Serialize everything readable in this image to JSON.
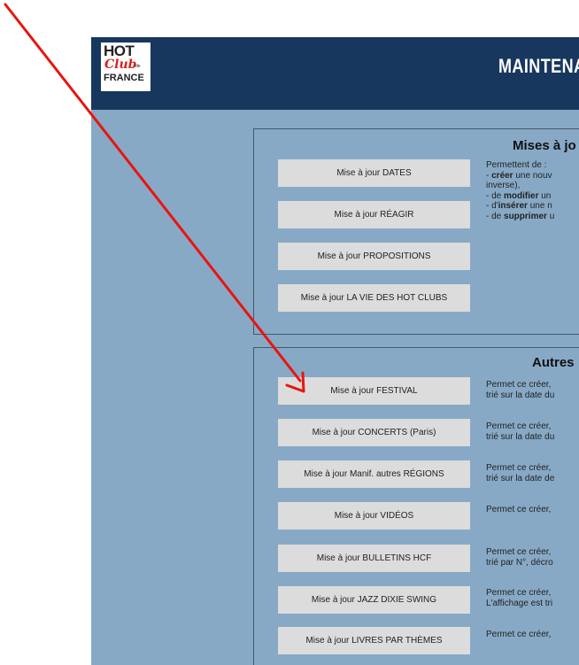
{
  "header": {
    "logo": {
      "line1": "HOT",
      "line2": "Club",
      "line2b": "de",
      "line3": "FRANCE"
    },
    "title": "MAINTENA"
  },
  "panel1": {
    "title": "Mises à jo",
    "buttons": [
      "Mise à jour DATES",
      "Mise à jour RÉAGIR",
      "Mise à jour PROPOSITIONS",
      "Mise à jour LA VIE DES HOT CLUBS"
    ],
    "desc": {
      "intro": "Permettent de :",
      "l1_dash": "- ",
      "l1_bold": "créer",
      "l1_rest": " une nouv",
      "l2": "inverse),",
      "l3_pre": "- de ",
      "l3_bold": "modifier",
      "l3_rest": " un",
      "l4_pre": "- d'",
      "l4_bold": "insérer",
      "l4_rest": " une n",
      "l5_pre": "- de ",
      "l5_bold": "supprimer",
      "l5_rest": " u"
    }
  },
  "panel2": {
    "title": "Autres",
    "items": [
      {
        "label": "Mise à jour FESTIVAL",
        "desc": [
          "Permet ce créer,",
          "trié sur la date du"
        ]
      },
      {
        "label": "Mise à jour CONCERTS (Paris)",
        "desc": [
          "Permet ce créer,",
          "trié sur la date du"
        ]
      },
      {
        "label": "Mise à jour Manif. autres RÉGIONS",
        "desc": [
          "Permet ce créer,",
          "trié sur la date de"
        ]
      },
      {
        "label": "Mise à jour VIDÉOS",
        "desc": [
          "Permet ce créer,",
          ""
        ]
      },
      {
        "label": "Mise à jour BULLETINS HCF",
        "desc": [
          "Permet ce créer,",
          "trié par N°, décro"
        ]
      },
      {
        "label": "Mise à jour JAZZ DIXIE SWING",
        "desc": [
          "Permet ce créer,",
          "L'affichage est tri"
        ]
      },
      {
        "label": "Mise à jour LIVRES PAR THÈMES",
        "desc": [
          "Permet ce créer,",
          ""
        ]
      }
    ]
  },
  "colors": {
    "header_bg": "#17375e",
    "content_bg": "#87a9c6",
    "button_bg": "#dcdcdc",
    "arrow": "#e8150f"
  }
}
